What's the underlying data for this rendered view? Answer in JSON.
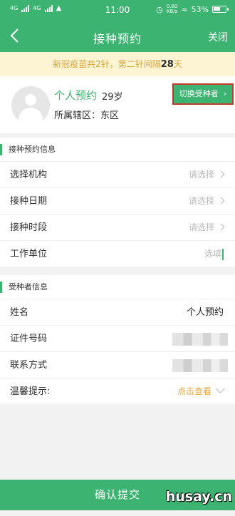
{
  "status_bar": {
    "network_left": "4G",
    "network_right": "4G",
    "time": "11:00",
    "speed_value": "0.60",
    "speed_unit": "KB/s",
    "battery": "53%"
  },
  "nav": {
    "title": "接种预约",
    "close_label": "关闭"
  },
  "notice": {
    "text_before": "新冠疫苗共2针，第二针间隔",
    "days": "28",
    "text_after": "天"
  },
  "profile": {
    "name": "个人预约",
    "age": "29岁",
    "area_label": "所属辖区：",
    "area_value": "东区",
    "switch_label": "切换受种者"
  },
  "appointment": {
    "title": "接种预约信息",
    "rows": [
      {
        "label": "选择机构",
        "value": "请选择"
      },
      {
        "label": "接种日期",
        "value": "请选择"
      },
      {
        "label": "接种时段",
        "value": "请选择"
      },
      {
        "label": "工作单位",
        "value": "选填"
      }
    ]
  },
  "recipient": {
    "title": "受种者信息",
    "name_label": "姓名",
    "name_value": "个人预约",
    "id_label": "证件号码",
    "contact_label": "联系方式",
    "tip_label": "温馨提示:",
    "tip_action": "点击查看"
  },
  "submit_label": "确认提交",
  "watermark": "husay.cn",
  "colors": {
    "brand": "#3cb371",
    "notice_bg": "#fdf4d4",
    "notice_text": "#d7a53a",
    "highlight_border": "#c0392b"
  }
}
